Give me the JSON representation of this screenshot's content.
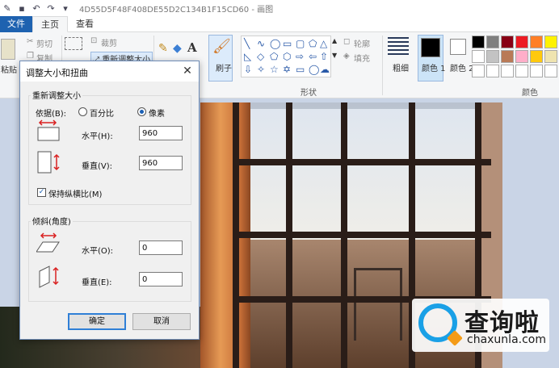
{
  "titlebar": {
    "title": "4D55D5F48F408DE55D2C134B1F15CD60 - 画图"
  },
  "tabs": [
    {
      "label": "文件"
    },
    {
      "label": "主页"
    },
    {
      "label": "查看"
    }
  ],
  "ribbon": {
    "paste": "粘贴",
    "cut": "剪切",
    "copy": "复制",
    "crop": "裁剪",
    "resize": "重新调整大小",
    "brush": "刷子",
    "outline": "轮廓",
    "fill": "填充",
    "size": "粗细",
    "color1": "颜色 1",
    "color2": "颜色 2",
    "group_shapes": "形状",
    "group_colors": "颜色",
    "group_clipboard": "剪"
  },
  "palette": [
    "#000000",
    "#7f7f7f",
    "#880015",
    "#ed1c24",
    "#ff7f27",
    "#fff200",
    "#ffffff",
    "#c3c3c3",
    "#b97a57",
    "#ffaec9",
    "#ffc90e",
    "#efe4b0",
    "#ffffff",
    "#ffffff",
    "#ffffff",
    "#ffffff",
    "#ffffff",
    "#ffffff"
  ],
  "dialog": {
    "title": "调整大小和扭曲",
    "resize_group": "重新调整大小",
    "by_label": "依据(B):",
    "percent": "百分比",
    "pixels": "像素",
    "horizontal": "水平(H):",
    "horizontal_value": "960",
    "vertical": "垂直(V):",
    "vertical_value": "960",
    "keep_ratio": "保持纵横比(M)",
    "skew_group": "倾斜(角度)",
    "skew_h": "水平(O):",
    "skew_h_value": "0",
    "skew_v": "垂直(E):",
    "skew_v_value": "0",
    "ok": "确定",
    "cancel": "取消"
  },
  "watermark": {
    "cn": "查询啦",
    "en": "chaxunla.com"
  },
  "colors": {
    "accent": "#1e62b0",
    "dialog_bg": "#f0f0f0",
    "selection": "#cce4f7"
  }
}
